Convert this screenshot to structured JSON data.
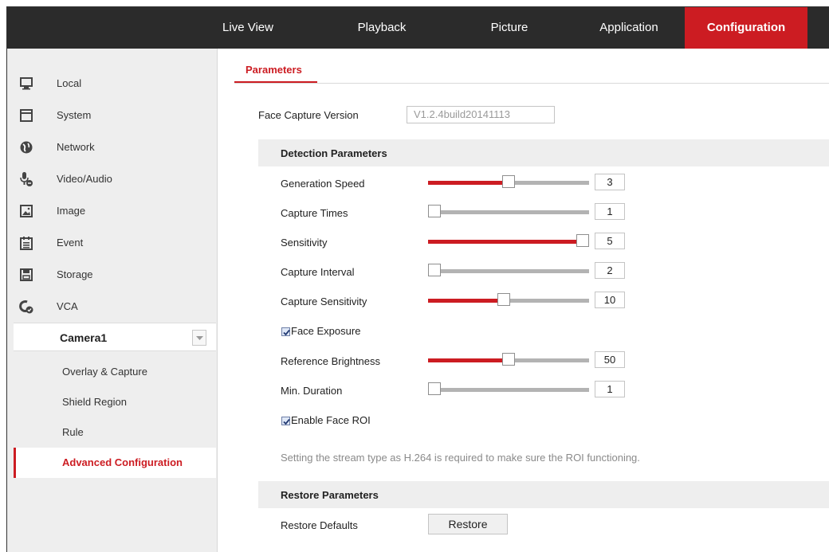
{
  "topnav": {
    "items": [
      {
        "label": "Live View"
      },
      {
        "label": "Playback"
      },
      {
        "label": "Picture"
      },
      {
        "label": "Application"
      },
      {
        "label": "Configuration",
        "active": true
      }
    ]
  },
  "sidebar": {
    "items": [
      {
        "label": "Local",
        "icon": "monitor-icon"
      },
      {
        "label": "System",
        "icon": "system-icon"
      },
      {
        "label": "Network",
        "icon": "globe-icon"
      },
      {
        "label": "Video/Audio",
        "icon": "microphone-icon"
      },
      {
        "label": "Image",
        "icon": "image-icon"
      },
      {
        "label": "Event",
        "icon": "calendar-icon"
      },
      {
        "label": "Storage",
        "icon": "floppy-disk-icon"
      },
      {
        "label": "VCA",
        "icon": "vca-icon"
      }
    ],
    "camera": {
      "label": "Camera1"
    },
    "subitems": [
      {
        "label": "Overlay & Capture"
      },
      {
        "label": "Shield Region"
      },
      {
        "label": "Rule"
      },
      {
        "label": "Advanced Configuration",
        "active": true
      }
    ]
  },
  "main": {
    "tab": {
      "label": "Parameters"
    },
    "face_capture_version": {
      "label": "Face Capture Version",
      "value": "V1.2.4build20141113"
    },
    "detection_section": {
      "title": "Detection Parameters"
    },
    "sliders": [
      {
        "label": "Generation Speed",
        "value": "3",
        "fraction": 0.5
      },
      {
        "label": "Capture Times",
        "value": "1",
        "fraction": 0
      },
      {
        "label": "Sensitivity",
        "value": "5",
        "fraction": 1
      },
      {
        "label": "Capture Interval",
        "value": "2",
        "fraction": 0
      },
      {
        "label": "Capture Sensitivity",
        "value": "10",
        "fraction": 0.47
      }
    ],
    "face_exposure": {
      "label": "Face Exposure",
      "checked": true
    },
    "exposure_sliders": [
      {
        "label": "Reference Brightness",
        "value": "50",
        "fraction": 0.5
      },
      {
        "label": "Min. Duration",
        "value": "1",
        "fraction": 0
      }
    ],
    "face_roi": {
      "label": "Enable Face ROI",
      "checked": true
    },
    "roi_note": "Setting the stream type as H.264 is required to make sure the ROI functioning.",
    "restore_section": {
      "title": "Restore Parameters"
    },
    "restore_defaults": {
      "label": "Restore Defaults",
      "button": "Restore"
    }
  },
  "colors": {
    "accent": "#cc1c22",
    "nav_bg": "#2b2b2b",
    "sidebar_bg": "#eeeeee",
    "slider_track": "#b3b3b3"
  }
}
